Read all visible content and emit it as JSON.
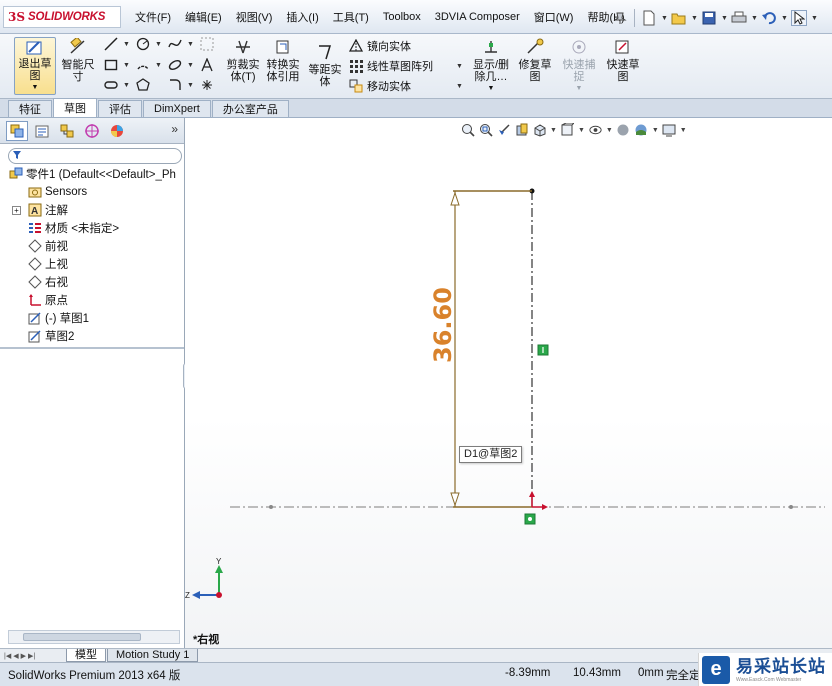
{
  "app": {
    "logo_ds": "3S",
    "logo_brand": "SOLIDWORKS"
  },
  "menu": [
    "文件(F)",
    "编辑(E)",
    "视图(V)",
    "插入(I)",
    "工具(T)",
    "Toolbox",
    "3DVIA Composer",
    "窗口(W)",
    "帮助(H)"
  ],
  "standard_toolbar": {
    "icons": [
      "pin-icon",
      "new-file-icon",
      "open-folder-icon",
      "save-icon",
      "print-icon",
      "undo-icon",
      "select-cursor-icon"
    ]
  },
  "command_manager": {
    "exit_sketch": "退出草\n图",
    "smart_dimension": "智能尺\n寸",
    "trim_entities": "剪裁实\n体(T)",
    "convert_entities": "转换实\n体引用",
    "offset_entities": "等距实\n体",
    "mirror_entities": "镜向实体",
    "linear_pattern": "线性草图阵列",
    "move_entities": "移动实体",
    "display_delete": "显示/删\n除几…",
    "repair_sketch": "修复草\n图",
    "quick_snaps": "快速捕\n捉",
    "rapid_sketch": "快速草\n图"
  },
  "command_tabs": [
    {
      "label": "特征",
      "active": false
    },
    {
      "label": "草图",
      "active": true
    },
    {
      "label": "评估",
      "active": false
    },
    {
      "label": "DimXpert",
      "active": false
    },
    {
      "label": "办公室产品",
      "active": false
    }
  ],
  "feature_manager": {
    "tabs": [
      "feature-tree-icon",
      "property-manager-icon",
      "configuration-manager-icon",
      "dimxpert-manager-icon",
      "display-manager-icon"
    ],
    "more": "»",
    "tree": [
      {
        "label": "零件1  (Default<<Default>_Ph",
        "icon": "part-icon",
        "indent": 0,
        "expander": false
      },
      {
        "label": "Sensors",
        "icon": "sensors-icon",
        "indent": 1,
        "expander": false
      },
      {
        "label": "注解",
        "icon": "annotations-icon",
        "indent": 1,
        "expander": true
      },
      {
        "label": "材质 <未指定>",
        "icon": "material-icon",
        "indent": 1,
        "expander": false
      },
      {
        "label": "前视",
        "icon": "plane-icon",
        "indent": 1,
        "expander": false
      },
      {
        "label": "上视",
        "icon": "plane-icon",
        "indent": 1,
        "expander": false
      },
      {
        "label": "右视",
        "icon": "plane-icon",
        "indent": 1,
        "expander": false
      },
      {
        "label": "原点",
        "icon": "origin-icon",
        "indent": 1,
        "expander": false
      },
      {
        "label": "(-) 草图1",
        "icon": "sketch-icon",
        "indent": 1,
        "expander": false
      },
      {
        "label": "草图2",
        "icon": "sketch-icon",
        "indent": 1,
        "expander": false
      }
    ]
  },
  "graphics": {
    "dimension_value": "36.60",
    "dimension_tag": "D1@草图2",
    "view_label": "*右视",
    "triad": {
      "y": "Y",
      "z": "Z"
    }
  },
  "bottom_tabs": [
    {
      "label": "模型",
      "active": true
    },
    {
      "label": "Motion Study 1",
      "active": false
    }
  ],
  "status_bar": {
    "app": "SolidWorks Premium 2013 x64 版",
    "x": "-8.39mm",
    "y": "10.43mm",
    "z": "0mm",
    "state": "完全定"
  },
  "watermark": {
    "logo": "e",
    "title": "易采站长站",
    "subtitle": "Www.Easck.Com Webmaster"
  },
  "colors": {
    "dimension": "#d9822b",
    "sketch_line": "#8a6a2a",
    "relation": "#2aa84a",
    "origin": "#c8102e",
    "accent": "#1a5aa8"
  }
}
